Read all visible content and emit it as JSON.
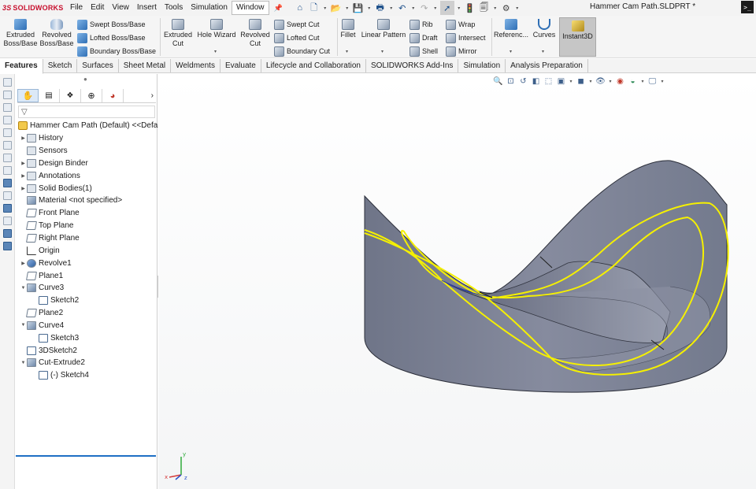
{
  "app": {
    "brand": "SOLIDWORKS",
    "doc_title": "Hammer Cam Path.SLDPRT *"
  },
  "menu": [
    "File",
    "Edit",
    "View",
    "Insert",
    "Tools",
    "Simulation",
    "Window"
  ],
  "active_menu": "Window",
  "ribbon": {
    "extruded_boss": "Extruded\nBoss/Base",
    "revolved_boss": "Revolved\nBoss/Base",
    "swept_boss": "Swept Boss/Base",
    "lofted_boss": "Lofted Boss/Base",
    "boundary_boss": "Boundary Boss/Base",
    "extruded_cut": "Extruded\nCut",
    "hole_wizard": "Hole Wizard",
    "revolved_cut": "Revolved\nCut",
    "swept_cut": "Swept Cut",
    "lofted_cut": "Lofted Cut",
    "boundary_cut": "Boundary Cut",
    "fillet": "Fillet",
    "linear_pattern": "Linear Pattern",
    "rib": "Rib",
    "draft": "Draft",
    "shell": "Shell",
    "wrap": "Wrap",
    "intersect": "Intersect",
    "mirror": "Mirror",
    "reference": "Referenc...",
    "curves": "Curves",
    "instant3d": "Instant3D"
  },
  "tabs": [
    "Features",
    "Sketch",
    "Surfaces",
    "Sheet Metal",
    "Weldments",
    "Evaluate",
    "Lifecycle and Collaboration",
    "SOLIDWORKS Add-Ins",
    "Simulation",
    "Analysis Preparation"
  ],
  "active_tab": "Features",
  "tree": [
    {
      "label": "Hammer Cam Path (Default) <<Defa",
      "icon": "part-icon",
      "level": 0,
      "expand": ""
    },
    {
      "label": "History",
      "icon": "history-icon",
      "level": 1,
      "expand": "right"
    },
    {
      "label": "Sensors",
      "icon": "sensors-icon",
      "level": 1,
      "expand": ""
    },
    {
      "label": "Design Binder",
      "icon": "design-binder-icon",
      "level": 1,
      "expand": "right"
    },
    {
      "label": "Annotations",
      "icon": "annotations-icon",
      "level": 1,
      "expand": "right"
    },
    {
      "label": "Solid Bodies(1)",
      "icon": "solid-bodies-icon",
      "level": 1,
      "expand": "right"
    },
    {
      "label": "Material <not specified>",
      "icon": "material-icon",
      "level": 1,
      "expand": ""
    },
    {
      "label": "Front Plane",
      "icon": "plane-icon",
      "level": 1,
      "expand": ""
    },
    {
      "label": "Top Plane",
      "icon": "plane-icon",
      "level": 1,
      "expand": ""
    },
    {
      "label": "Right Plane",
      "icon": "plane-icon",
      "level": 1,
      "expand": ""
    },
    {
      "label": "Origin",
      "icon": "origin-icon",
      "level": 1,
      "expand": ""
    },
    {
      "label": "Revolve1",
      "icon": "revolve-icon",
      "level": 1,
      "expand": "right"
    },
    {
      "label": "Plane1",
      "icon": "plane-icon",
      "level": 1,
      "expand": ""
    },
    {
      "label": "Curve3",
      "icon": "curve-icon",
      "level": 1,
      "expand": "down"
    },
    {
      "label": "Sketch2",
      "icon": "sketch-icon",
      "level": 2,
      "expand": ""
    },
    {
      "label": "Plane2",
      "icon": "plane-icon",
      "level": 1,
      "expand": ""
    },
    {
      "label": "Curve4",
      "icon": "curve-icon",
      "level": 1,
      "expand": "down"
    },
    {
      "label": "Sketch3",
      "icon": "sketch-icon",
      "level": 2,
      "expand": ""
    },
    {
      "label": "3DSketch2",
      "icon": "3dsketch-icon",
      "level": 1,
      "expand": ""
    },
    {
      "label": "Cut-Extrude2",
      "icon": "cut-extrude-icon",
      "level": 1,
      "expand": "down"
    },
    {
      "label": "(-) Sketch4",
      "icon": "sketch-icon",
      "level": 2,
      "expand": ""
    }
  ],
  "triad": {
    "x": "x",
    "y": "y",
    "z": "z"
  },
  "colors": {
    "accent": "#1f6fc4",
    "curve_highlight": "#f5f000",
    "body": "#7e8499",
    "brand": "#c8102e"
  }
}
